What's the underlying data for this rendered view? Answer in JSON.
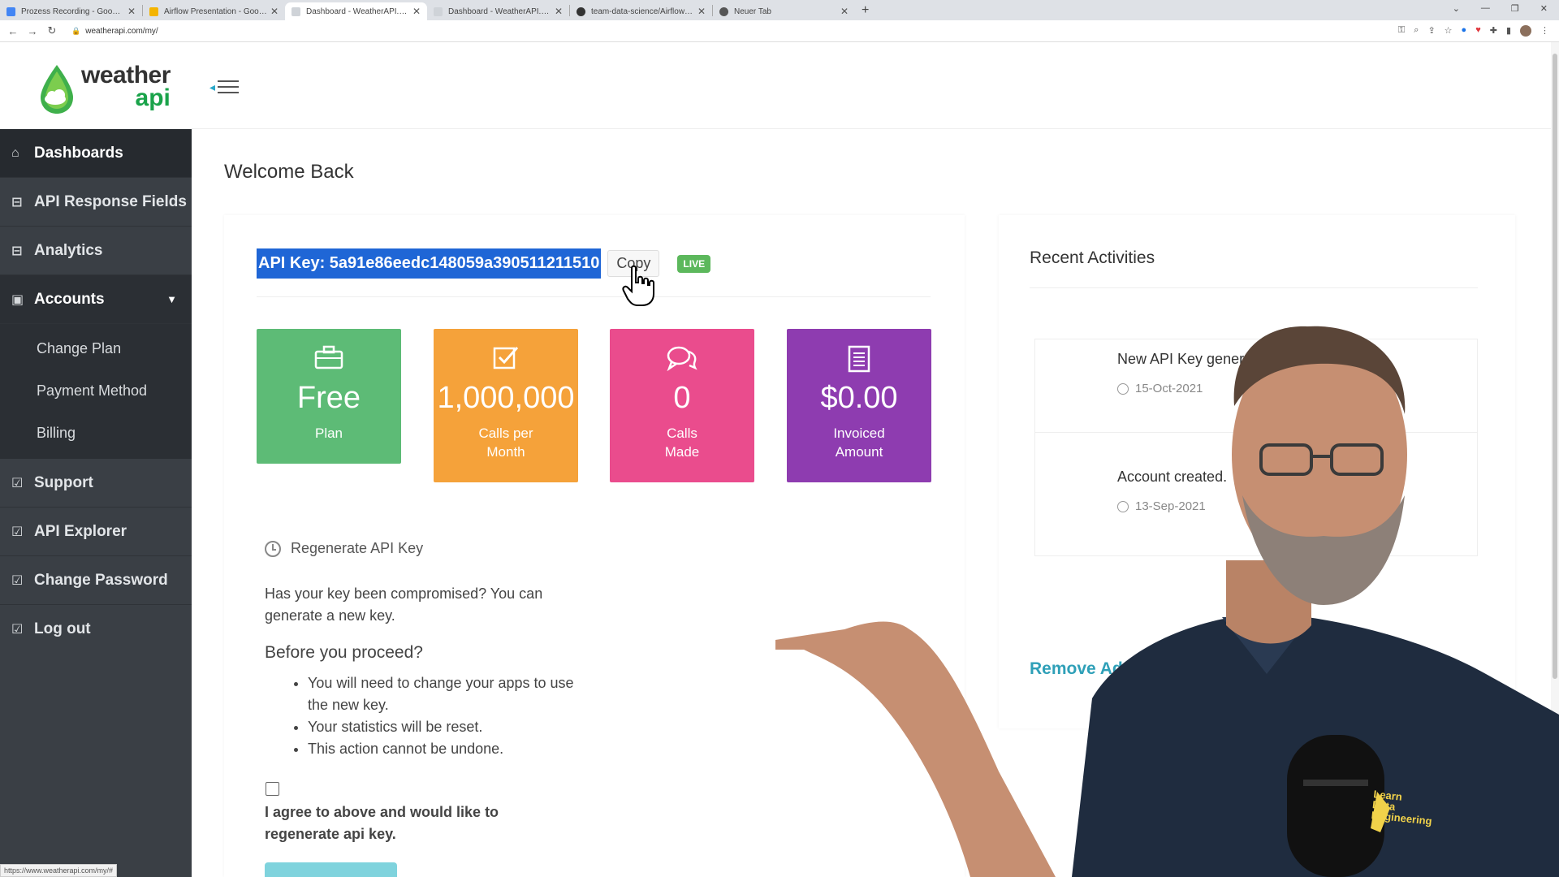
{
  "browser": {
    "tabs": [
      {
        "title": "Prozess Recording - Google Docs",
        "color": "#4285f4"
      },
      {
        "title": "Airflow Presentation - Google Sl",
        "color": "#f4b400"
      },
      {
        "title": "Dashboard - WeatherAPI.com",
        "color": "#cfd3d8"
      },
      {
        "title": "Dashboard - WeatherAPI.com",
        "color": "#cfd3d8"
      },
      {
        "title": "team-data-science/Airflow: Airflo",
        "color": "#333333"
      },
      {
        "title": "Neuer Tab",
        "color": "#555555"
      }
    ],
    "url": "weatherapi.com/my/",
    "status_url": "https://www.weatherapi.com/my/#"
  },
  "logo": {
    "word1": "weather",
    "word2": "api"
  },
  "sidebar": {
    "items": [
      {
        "label": "Dashboards",
        "icon": "home-icon"
      },
      {
        "label": "API Response Fields",
        "icon": "inbox-icon"
      },
      {
        "label": "Analytics",
        "icon": "inbox-icon"
      },
      {
        "label": "Accounts",
        "icon": "briefcase-icon"
      }
    ],
    "sub_items": [
      "Change Plan",
      "Payment Method",
      "Billing"
    ],
    "items_after": [
      {
        "label": "Support",
        "icon": "check-square-icon"
      },
      {
        "label": "API Explorer",
        "icon": "check-square-icon"
      },
      {
        "label": "Change Password",
        "icon": "check-square-icon"
      },
      {
        "label": "Log out",
        "icon": "check-square-icon"
      }
    ]
  },
  "main": {
    "welcome": "Welcome Back",
    "api_key_text": "API Key: 5a91e86eedc148059a390511211510",
    "copy_label": "Copy",
    "live_badge": "LIVE",
    "stats": [
      {
        "value": "Free",
        "label1": "Plan",
        "label2": "",
        "color": "#5dbb76"
      },
      {
        "value": "1,000,000",
        "label1": "Calls per",
        "label2": "Month",
        "color": "#f5a23a"
      },
      {
        "value": "0",
        "label1": "Calls",
        "label2": "Made",
        "color": "#ea4c8d"
      },
      {
        "value": "$0.00",
        "label1": "Invoiced",
        "label2": "Amount",
        "color": "#8e3cb0"
      }
    ],
    "regen": {
      "title": "Regenerate API Key",
      "desc": "Has your key been compromised? You can generate a new key.",
      "proceed": "Before you proceed?",
      "bullets": [
        "You will need to change your apps to use the new key.",
        "Your statistics will be reset.",
        "This action cannot be undone."
      ],
      "agree": "I agree to above and would like to regenerate api key."
    }
  },
  "side_panel": {
    "title": "Recent Activities",
    "activities": [
      {
        "text": "New API Key generated.",
        "date": "15-Oct-2021"
      },
      {
        "text": "Account created.",
        "date": "13-Sep-2021"
      }
    ],
    "remove_ads": "Remove Ads"
  },
  "overlay": {
    "watermark": [
      "Learn",
      "Data",
      "Engineering"
    ]
  }
}
